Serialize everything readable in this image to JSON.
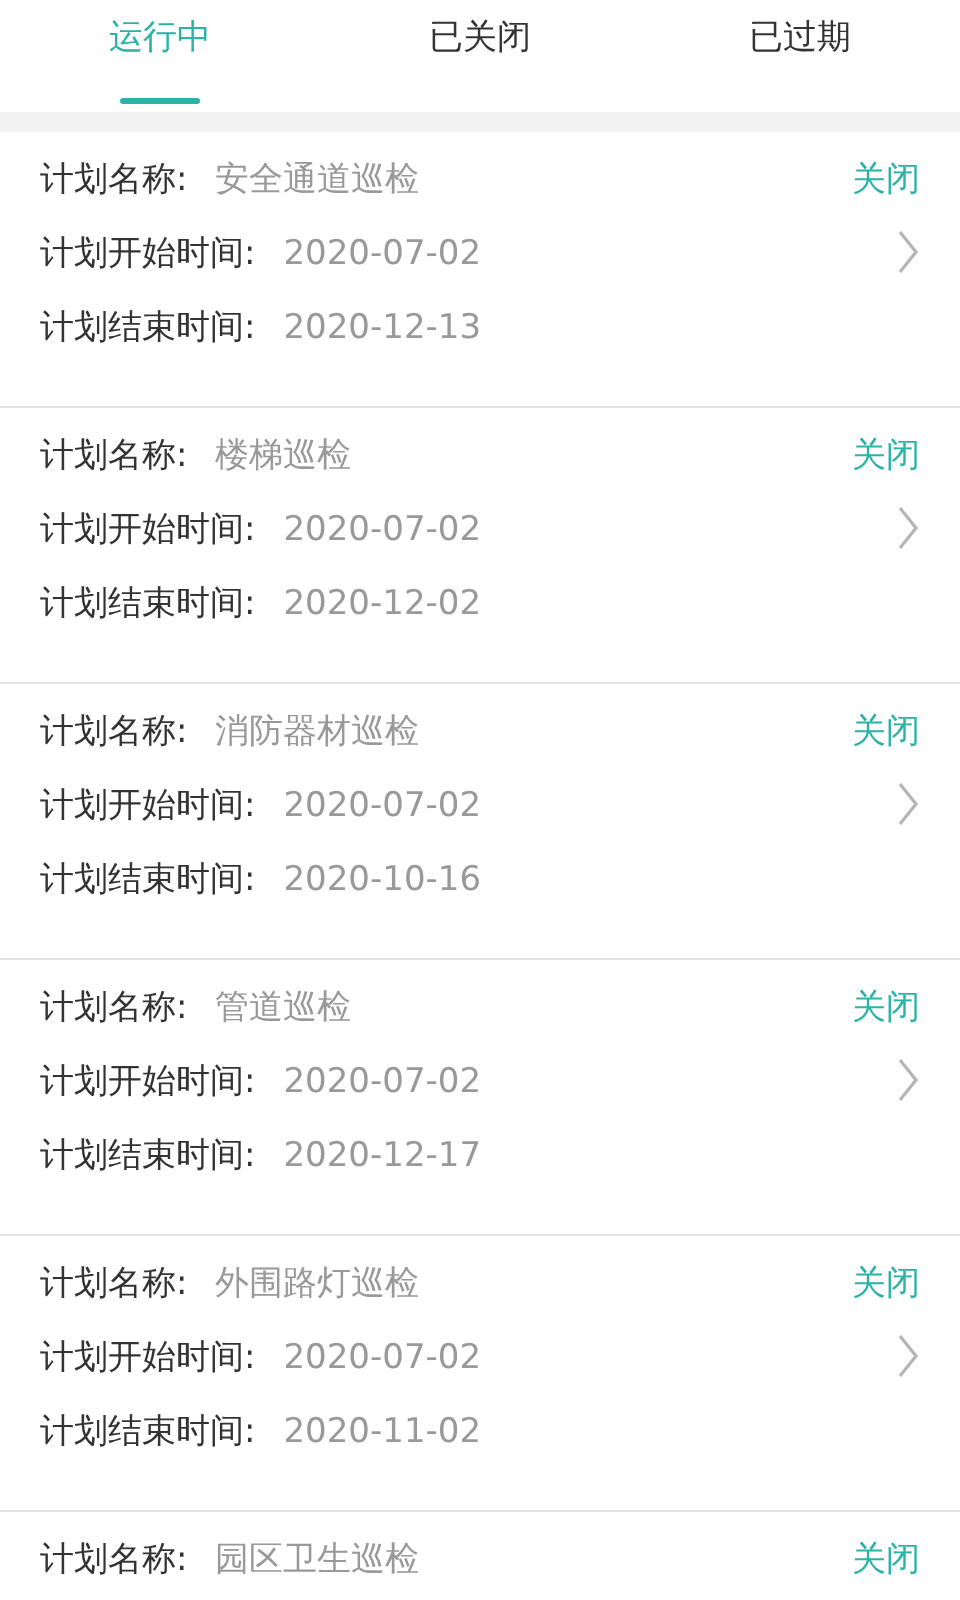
{
  "tabs": [
    {
      "label": "运行中",
      "selected": true
    },
    {
      "label": "已关闭",
      "selected": false
    },
    {
      "label": "已过期",
      "selected": false
    }
  ],
  "plans": [
    {
      "name_label": "计划名称:",
      "name": "安全通道巡检",
      "action": "关闭",
      "start_label": "计划开始时间:",
      "start": "2020-07-02",
      "end_label": "计划结束时间:",
      "end": "2020-12-13"
    },
    {
      "name_label": "计划名称:",
      "name": "楼梯巡检",
      "action": "关闭",
      "start_label": "计划开始时间:",
      "start": "2020-07-02",
      "end_label": "计划结束时间:",
      "end": "2020-12-02"
    },
    {
      "name_label": "计划名称:",
      "name": "消防器材巡检",
      "action": "关闭",
      "start_label": "计划开始时间:",
      "start": "2020-07-02",
      "end_label": "计划结束时间:",
      "end": "2020-10-16"
    },
    {
      "name_label": "计划名称:",
      "name": "管道巡检",
      "action": "关闭",
      "start_label": "计划开始时间:",
      "start": "2020-07-02",
      "end_label": "计划结束时间:",
      "end": "2020-12-17"
    },
    {
      "name_label": "计划名称:",
      "name": "外围路灯巡检",
      "action": "关闭",
      "start_label": "计划开始时间:",
      "start": "2020-07-02",
      "end_label": "计划结束时间:",
      "end": "2020-11-02"
    },
    {
      "name_label": "计划名称:",
      "name": "园区卫生巡检",
      "action": "关闭"
    }
  ]
}
